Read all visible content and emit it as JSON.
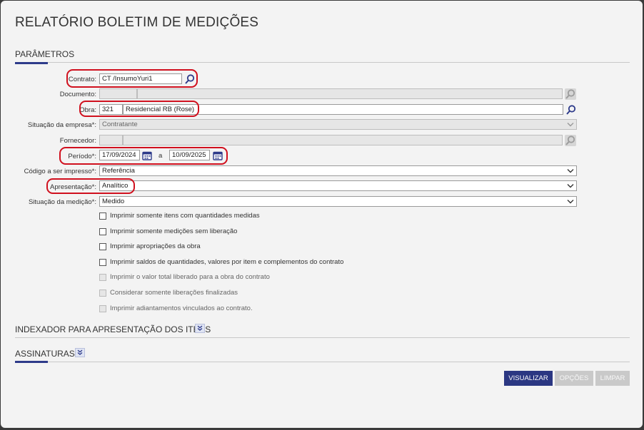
{
  "page": {
    "title": "RELATÓRIO BOLETIM DE MEDIÇÕES"
  },
  "sections": {
    "parametros": "PARÂMETROS",
    "indexador": "INDEXADOR PARA APRESENTAÇÃO DOS ITENS",
    "assinaturas": "ASSINATURAS"
  },
  "fields": {
    "contrato": {
      "label": "Contrato:",
      "value": "CT  /InsumoYuri1"
    },
    "documento": {
      "label": "Documento:",
      "code": "",
      "desc": ""
    },
    "obra": {
      "label": "Obra:",
      "code": "321",
      "desc": "Residencial RB (Rose)"
    },
    "situacao_empresa": {
      "label": "Situação da empresa*:",
      "value": "Contratante"
    },
    "fornecedor": {
      "label": "Fornecedor:",
      "code": "",
      "desc": ""
    },
    "periodo": {
      "label": "Período*:",
      "start": "17/09/2024",
      "sep": "a",
      "end": "10/09/2025"
    },
    "codigo_impresso": {
      "label": "Código a ser impresso*:",
      "value": "Referência"
    },
    "apresentacao": {
      "label": "Apresentação*:",
      "value": "Analítico"
    },
    "situacao_medicao": {
      "label": "Situação da medição*:",
      "value": "Medido"
    }
  },
  "checkboxes": [
    {
      "label": "Imprimir somente itens com quantidades medidas",
      "enabled": true,
      "checked": false
    },
    {
      "label": "Imprimir somente medições sem liberação",
      "enabled": true,
      "checked": false
    },
    {
      "label": "Imprimir apropriações da obra",
      "enabled": true,
      "checked": false
    },
    {
      "label": "Imprimir saldos de quantidades, valores por item e complementos do contrato",
      "enabled": true,
      "checked": false
    },
    {
      "label": "Imprimir o valor total liberado para a obra do contrato",
      "enabled": false,
      "checked": false
    },
    {
      "label": "Considerar somente liberações finalizadas",
      "enabled": false,
      "checked": false
    },
    {
      "label": "Imprimir adiantamentos vinculados ao contrato.",
      "enabled": false,
      "checked": false
    }
  ],
  "buttons": {
    "visualizar": "VISUALIZAR",
    "opcoes": "OPÇÕES",
    "limpar": "LIMPAR"
  },
  "colors": {
    "accent": "#2e3b8a",
    "highlight": "#d0101e",
    "primary_button": "#2b3782"
  }
}
